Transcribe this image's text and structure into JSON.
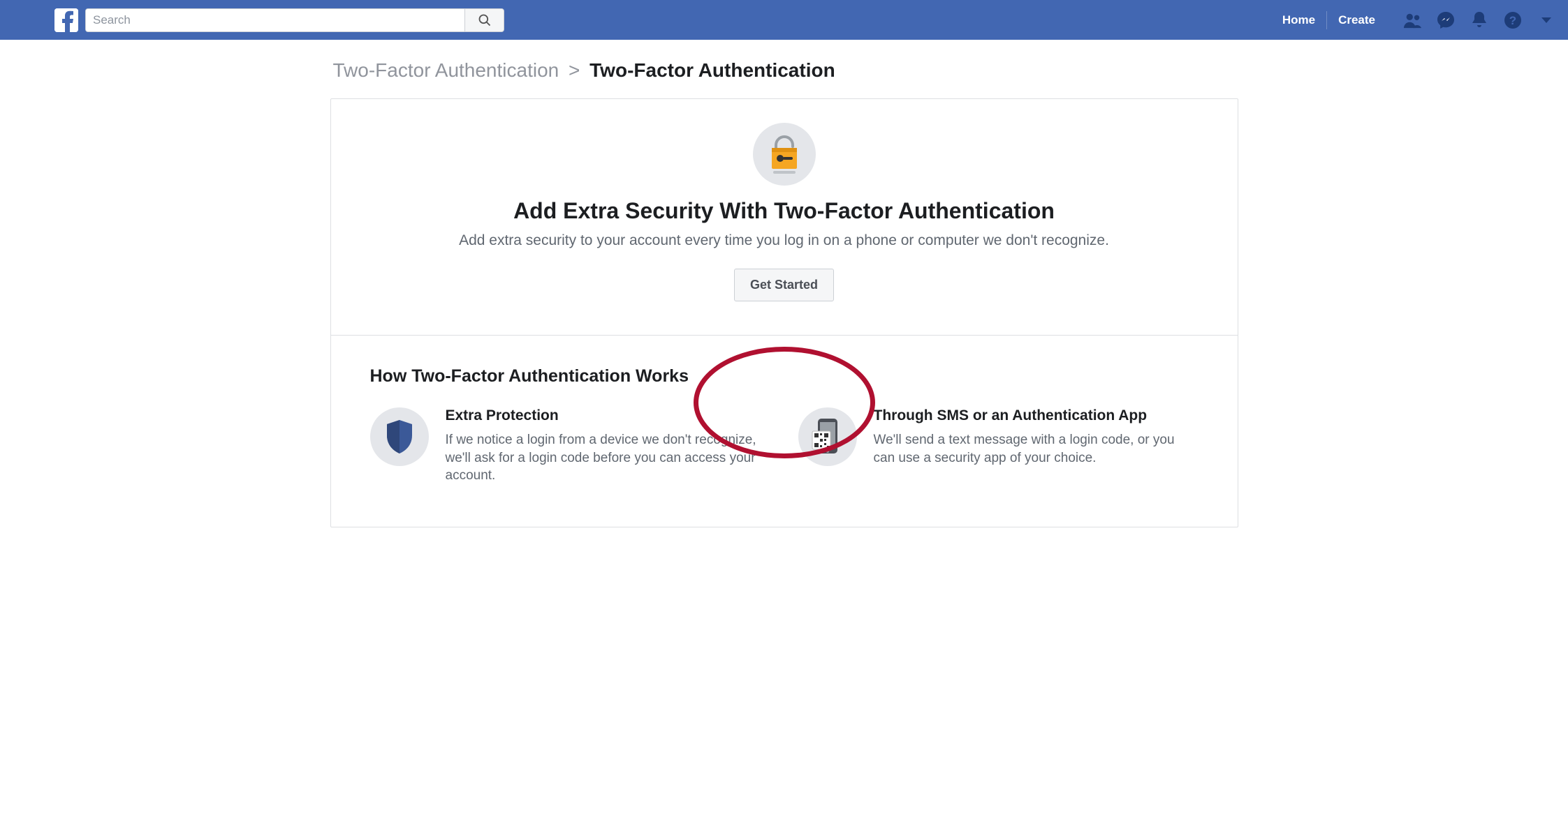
{
  "topbar": {
    "search_placeholder": "Search",
    "nav": {
      "home": "Home",
      "create": "Create"
    }
  },
  "breadcrumb": {
    "parent": "Two-Factor Authentication",
    "separator": ">",
    "current": "Two-Factor Authentication"
  },
  "hero": {
    "title": "Add Extra Security With Two-Factor Authentication",
    "subtitle": "Add extra security to your account every time you log in on a phone or computer we don't recognize.",
    "cta": "Get Started"
  },
  "how": {
    "heading": "How Two-Factor Authentication Works",
    "items": [
      {
        "title": "Extra Protection",
        "body": "If we notice a login from a device we don't recognize, we'll ask for a login code before you can access your account."
      },
      {
        "title": "Through SMS or an Authentication App",
        "body": "We'll send a text message with a login code, or you can use a security app of your choice."
      }
    ]
  },
  "colors": {
    "brand": "#4267b2",
    "annotation": "#b01030"
  }
}
